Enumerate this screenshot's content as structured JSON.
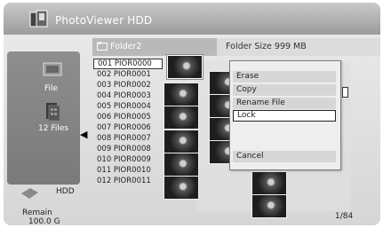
{
  "app": {
    "title": "PhotoViewer HDD"
  },
  "folder": {
    "name": "Folder2",
    "size_text": "Folder Size 999 MB"
  },
  "sidebar": {
    "file_label": "File",
    "files_count": "12 Files"
  },
  "storage": {
    "device": "HDD",
    "remain_label": "Remain",
    "remain_value": "100.0 G"
  },
  "files": [
    "001  PIOR0000",
    "002  PIOR0001",
    "003  PIOR0002",
    "004  PIOR0003",
    "005  PIOR0004",
    "006  PIOR0005",
    "007  PIOR0006",
    "008  PIOR0007",
    "009  PIOR0008",
    "010  PIOR0009",
    "011  PIOR0010",
    "012  PIOR0011"
  ],
  "selected_file_index": 0,
  "menu": {
    "items": [
      "Erase",
      "Copy",
      "Rename File",
      "Lock"
    ],
    "selected": "Lock",
    "cancel_label": "Cancel"
  },
  "pager": "1/84",
  "icons": {
    "app": "photo-viewer-icon",
    "folder": "folder-icon",
    "file": "file-icon",
    "files": "multiple-files-icon",
    "hdd": "hdd-icon",
    "arrow": "arrow-left-icon"
  }
}
